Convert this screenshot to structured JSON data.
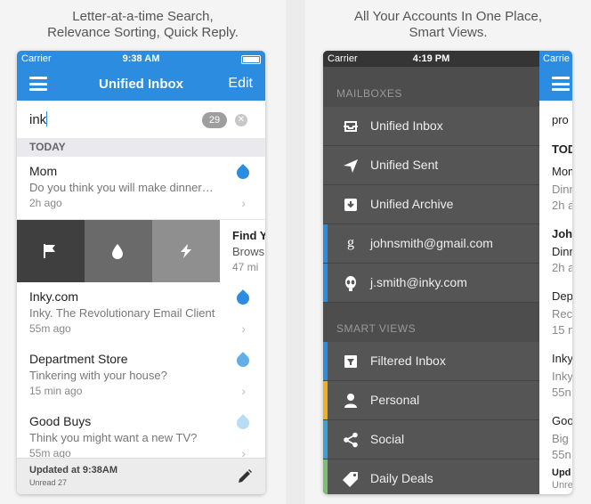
{
  "left": {
    "caption": [
      "Letter-at-a-time Search,",
      "Relevance Sorting, Quick Reply."
    ],
    "status": {
      "carrier": "Carrier",
      "time": "9:38 AM"
    },
    "navbar": {
      "title": "Unified Inbox",
      "edit": "Edit"
    },
    "search": {
      "query": "ink",
      "count": "29"
    },
    "section": "TODAY",
    "mails": [
      {
        "sender": "Mom",
        "preview": "Do you think you will make dinner…",
        "time": "2h ago"
      },
      {
        "sender": "Inky.com",
        "preview": "Inky. The Revolutionary Email Client",
        "time": "55m ago"
      },
      {
        "sender": "Department Store",
        "preview": "Tinkering with your house?",
        "time": "15 min ago"
      },
      {
        "sender": "Good Buys",
        "preview": "Think you might want a new TV?",
        "time": "55m ago"
      }
    ],
    "swipe_peek": {
      "sender": "Find Y",
      "preview": "Brows",
      "time": "47 mi"
    },
    "footer": {
      "updated": "Updated at 9:38AM",
      "unread": "Unread 27"
    },
    "colors": {
      "accent": "#2b8ce0",
      "flag_bg": "#3f3f3f",
      "drop_bg": "#6a6a6a",
      "bolt_bg": "#8f8f8f"
    }
  },
  "right": {
    "caption": [
      "All Your Accounts In One Place,",
      "Smart Views."
    ],
    "status": {
      "carrier": "Carrier",
      "time": "4:19 PM"
    },
    "mailboxes_header": "MAILBOXES",
    "mailboxes": [
      {
        "label": "Unified Inbox",
        "icon": "inbox-icon",
        "accent": ""
      },
      {
        "label": "Unified Sent",
        "icon": "send-icon",
        "accent": ""
      },
      {
        "label": "Unified Archive",
        "icon": "archive-icon",
        "accent": ""
      },
      {
        "label": "johnsmith@gmail.com",
        "icon": "google-icon",
        "accent": "#2b8ce0"
      },
      {
        "label": "j.smith@inky.com",
        "icon": "alien-icon",
        "accent": "#2b8ce0"
      }
    ],
    "smart_header": "SMART VIEWS",
    "smart_views": [
      {
        "label": "Filtered Inbox",
        "icon": "filter-icon",
        "accent": "#2b8ce0"
      },
      {
        "label": "Personal",
        "icon": "person-icon",
        "accent": "#f0b020"
      },
      {
        "label": "Social",
        "icon": "share-icon",
        "accent": "#3aa0d8"
      },
      {
        "label": "Daily Deals",
        "icon": "tag-icon",
        "accent": "#7ac070"
      }
    ],
    "peek": {
      "status": "Carrie",
      "lines": [
        {
          "text": "pro",
          "sub": false
        },
        {
          "text": "TOD",
          "sub": false
        },
        {
          "text": "Mom",
          "sub": false
        },
        {
          "text": "Dinn",
          "sub": true
        },
        {
          "text": "2h a",
          "sub": true
        },
        {
          "text": "John",
          "sub": false
        },
        {
          "text": "Dinn",
          "sub": false
        },
        {
          "text": "2h a",
          "sub": true
        },
        {
          "text": "Dep",
          "sub": false
        },
        {
          "text": "Rec",
          "sub": true
        },
        {
          "text": "15 n",
          "sub": true
        },
        {
          "text": "Inky",
          "sub": false
        },
        {
          "text": "Inky",
          "sub": true
        },
        {
          "text": "55n",
          "sub": true
        },
        {
          "text": "Goo",
          "sub": false
        },
        {
          "text": "Big",
          "sub": true
        },
        {
          "text": "55n",
          "sub": true
        },
        {
          "text": "Upd",
          "sub": false
        },
        {
          "text": "Unre",
          "sub": true
        }
      ]
    }
  }
}
